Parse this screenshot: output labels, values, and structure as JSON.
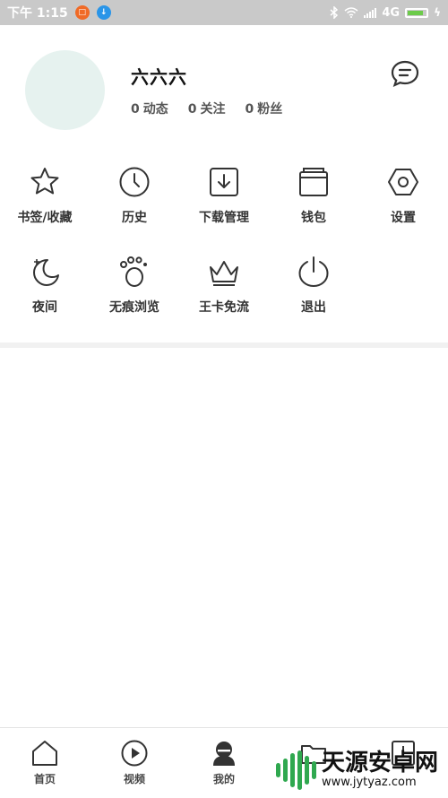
{
  "status_bar": {
    "time": "下午 1:15",
    "network": "4G"
  },
  "profile": {
    "username": "六六六",
    "stats": [
      {
        "count": "0",
        "label": "动态"
      },
      {
        "count": "0",
        "label": "关注"
      },
      {
        "count": "0",
        "label": "粉丝"
      }
    ]
  },
  "menu": {
    "row1": [
      {
        "label": "书签/收藏",
        "icon": "star-icon"
      },
      {
        "label": "历史",
        "icon": "clock-icon"
      },
      {
        "label": "下载管理",
        "icon": "download-icon"
      },
      {
        "label": "钱包",
        "icon": "wallet-icon"
      },
      {
        "label": "设置",
        "icon": "settings-icon"
      }
    ],
    "row2": [
      {
        "label": "夜间",
        "icon": "moon-icon"
      },
      {
        "label": "无痕浏览",
        "icon": "footprint-icon"
      },
      {
        "label": "王卡免流",
        "icon": "crown-icon"
      },
      {
        "label": "退出",
        "icon": "power-icon"
      }
    ]
  },
  "bottom_nav": [
    {
      "label": "首页",
      "icon": "home-icon"
    },
    {
      "label": "视频",
      "icon": "play-icon"
    },
    {
      "label": "我的",
      "icon": "user-icon"
    },
    {
      "label": "",
      "icon": "folder-icon"
    },
    {
      "label": "",
      "icon": "download-box-icon"
    }
  ],
  "watermark": {
    "title": "天源安卓网",
    "url": "www.jytyaz.com"
  },
  "colors": {
    "avatar_bg": "#e6f2ef",
    "status_bar_bg": "#c9c9c9",
    "battery": "#6ccb4a",
    "watermark_green": "#2fa84f"
  }
}
